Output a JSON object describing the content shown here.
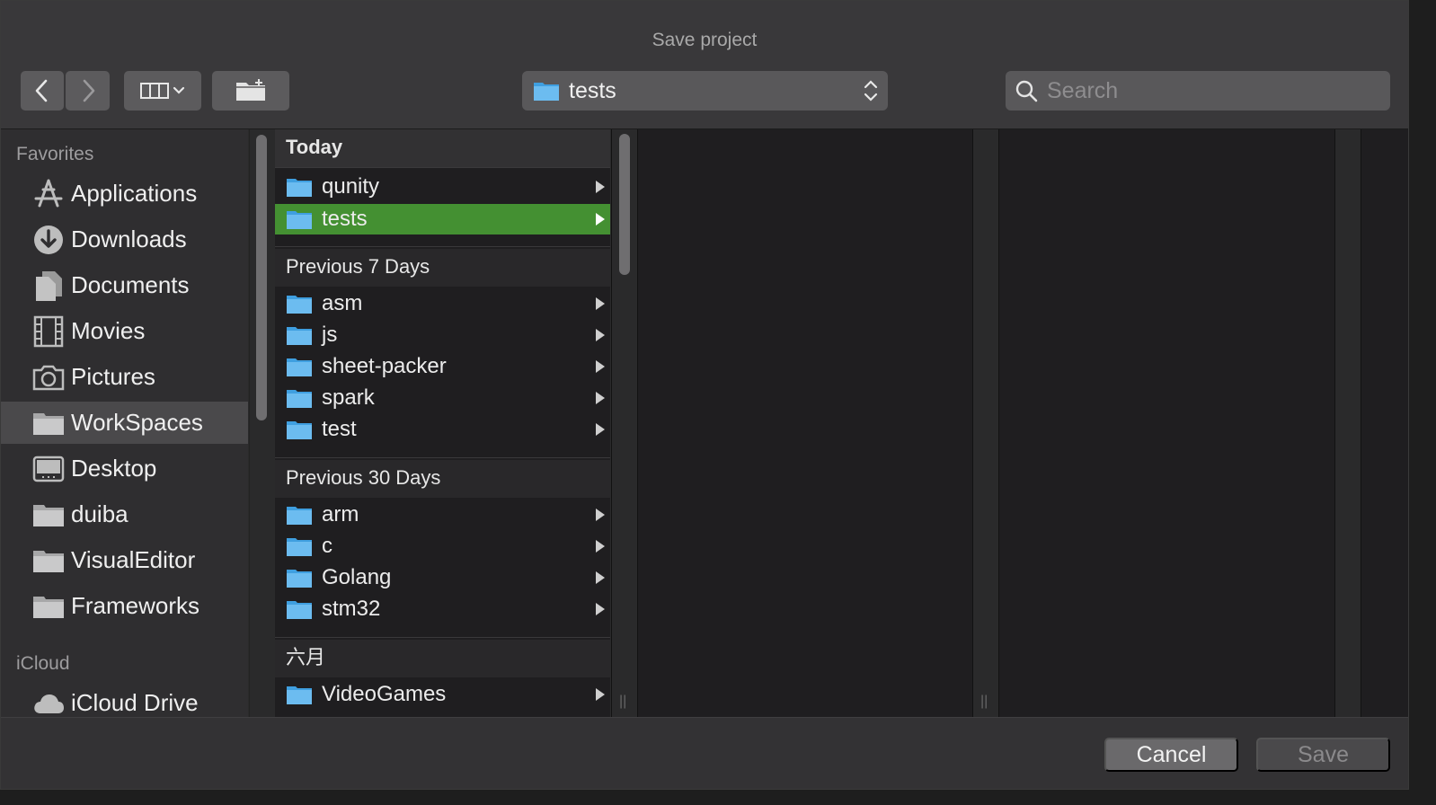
{
  "window": {
    "title": "Save project"
  },
  "toolbar": {
    "path_popup_label": "tests",
    "search_placeholder": "Search"
  },
  "sidebar": {
    "favorites_label": "Favorites",
    "items": [
      {
        "label": "Applications",
        "icon": "applications-icon"
      },
      {
        "label": "Downloads",
        "icon": "downloads-icon"
      },
      {
        "label": "Documents",
        "icon": "documents-icon"
      },
      {
        "label": "Movies",
        "icon": "movies-icon"
      },
      {
        "label": "Pictures",
        "icon": "pictures-icon"
      },
      {
        "label": "WorkSpaces",
        "icon": "folder-icon",
        "selected": true
      },
      {
        "label": "Desktop",
        "icon": "desktop-icon"
      },
      {
        "label": "duiba",
        "icon": "folder-icon"
      },
      {
        "label": "VisualEditor",
        "icon": "folder-icon"
      },
      {
        "label": "Frameworks",
        "icon": "folder-icon"
      }
    ],
    "icloud_label": "iCloud",
    "icloud_items": [
      {
        "label": "iCloud Drive",
        "icon": "cloud-icon"
      }
    ]
  },
  "browser": {
    "groups": [
      {
        "header": "Today",
        "items": [
          "qunity",
          "tests"
        ],
        "selected": "tests"
      },
      {
        "header": "Previous 7 Days",
        "items": [
          "asm",
          "js",
          "sheet-packer",
          "spark",
          "test"
        ]
      },
      {
        "header": "Previous 30 Days",
        "items": [
          "arm",
          "c",
          "Golang",
          "stm32"
        ]
      },
      {
        "header": "六月",
        "items": [
          "VideoGames"
        ]
      }
    ]
  },
  "footer": {
    "cancel_label": "Cancel",
    "save_label": "Save"
  },
  "colors": {
    "selection_green": "#449032",
    "folder_blue": "#5fb3ea"
  }
}
